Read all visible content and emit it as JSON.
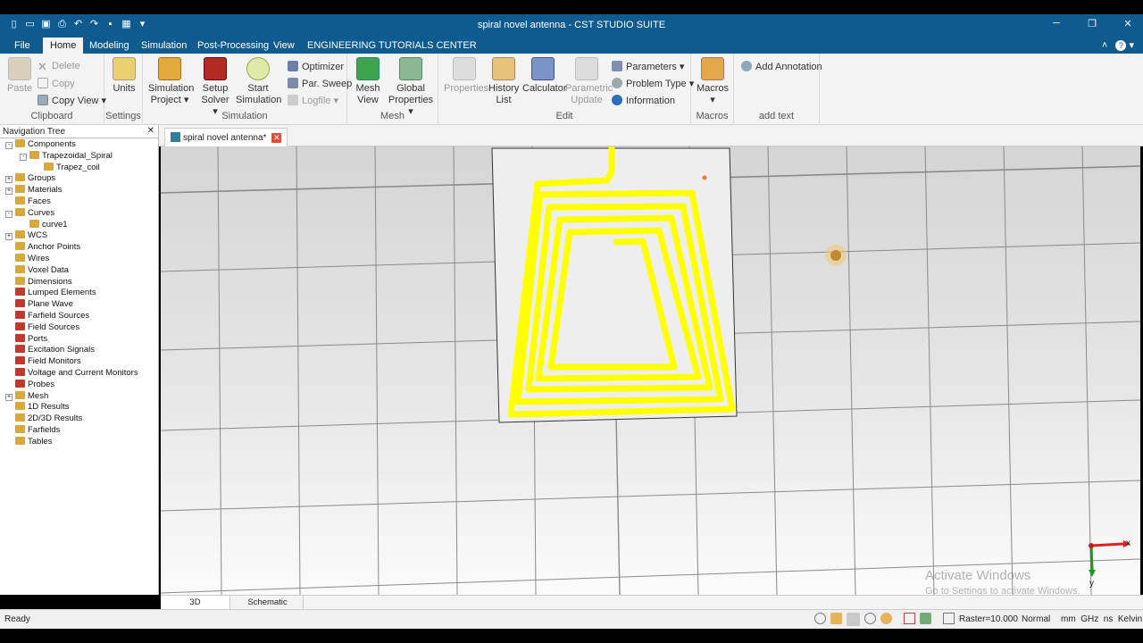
{
  "window": {
    "title": "spiral novel antenna - CST STUDIO SUITE"
  },
  "menu": {
    "tabs": [
      "File",
      "Home",
      "Modeling",
      "Simulation",
      "Post-Processing",
      "View",
      "ENGINEERING TUTORIALS CENTER"
    ],
    "active": "Home"
  },
  "ribbon": {
    "clipboard": {
      "label": "Clipboard",
      "paste": "Paste",
      "delete": "Delete",
      "copy": "Copy",
      "copy_view": "Copy View"
    },
    "settings": {
      "label": "Settings",
      "units": "Units"
    },
    "simulation": {
      "label": "Simulation",
      "sim_project_1": "Simulation",
      "sim_project_2": "Project",
      "setup_1": "Setup",
      "setup_2": "Solver",
      "start_1": "Start",
      "start_2": "Simulation",
      "optimizer": "Optimizer",
      "par_sweep": "Par. Sweep",
      "logfile": "Logfile"
    },
    "mesh": {
      "label": "Mesh",
      "mesh_view_1": "Mesh",
      "mesh_view_2": "View",
      "global_1": "Global",
      "global_2": "Properties"
    },
    "edit": {
      "label": "Edit",
      "properties": "Properties",
      "history_1": "History",
      "history_2": "List",
      "calculator": "Calculator",
      "param_1": "Parametric",
      "param_2": "Update",
      "parameters": "Parameters",
      "problem_type": "Problem Type",
      "information": "Information"
    },
    "macros": {
      "label": "Macros",
      "macros": "Macros"
    },
    "addtext": {
      "label": "add text",
      "add_annotation": "Add Annotation"
    }
  },
  "nav": {
    "header": "Navigation Tree",
    "items": [
      {
        "label": "Components",
        "indent": 0,
        "exp": "-"
      },
      {
        "label": "Trapezoidal_Spiral",
        "indent": 1,
        "exp": "-"
      },
      {
        "label": "Trapez_coil",
        "indent": 2,
        "exp": ""
      },
      {
        "label": "Groups",
        "indent": 0,
        "exp": "+"
      },
      {
        "label": "Materials",
        "indent": 0,
        "exp": "+"
      },
      {
        "label": "Faces",
        "indent": 0,
        "exp": ""
      },
      {
        "label": "Curves",
        "indent": 0,
        "exp": "-"
      },
      {
        "label": "curve1",
        "indent": 1,
        "exp": ""
      },
      {
        "label": "WCS",
        "indent": 0,
        "exp": "+"
      },
      {
        "label": "Anchor Points",
        "indent": 0,
        "exp": ""
      },
      {
        "label": "Wires",
        "indent": 0,
        "exp": ""
      },
      {
        "label": "Voxel Data",
        "indent": 0,
        "exp": ""
      },
      {
        "label": "Dimensions",
        "indent": 0,
        "exp": ""
      },
      {
        "label": "Lumped Elements",
        "indent": 0,
        "exp": ""
      },
      {
        "label": "Plane Wave",
        "indent": 0,
        "exp": ""
      },
      {
        "label": "Farfield Sources",
        "indent": 0,
        "exp": ""
      },
      {
        "label": "Field Sources",
        "indent": 0,
        "exp": ""
      },
      {
        "label": "Ports",
        "indent": 0,
        "exp": ""
      },
      {
        "label": "Excitation Signals",
        "indent": 0,
        "exp": ""
      },
      {
        "label": "Field Monitors",
        "indent": 0,
        "exp": ""
      },
      {
        "label": "Voltage and Current Monitors",
        "indent": 0,
        "exp": ""
      },
      {
        "label": "Probes",
        "indent": 0,
        "exp": ""
      },
      {
        "label": "Mesh",
        "indent": 0,
        "exp": "+"
      },
      {
        "label": "1D Results",
        "indent": 0,
        "exp": ""
      },
      {
        "label": "2D/3D Results",
        "indent": 0,
        "exp": ""
      },
      {
        "label": "Farfields",
        "indent": 0,
        "exp": ""
      },
      {
        "label": "Tables",
        "indent": 0,
        "exp": ""
      }
    ]
  },
  "document": {
    "tab": "spiral novel antenna*"
  },
  "view": {
    "axis_x": "x",
    "axis_y": "y",
    "watermark_1": "Activate Windows",
    "watermark_2": "Go to Settings to activate Windows.",
    "spiral_color": "#ffff00"
  },
  "bottom_tabs": {
    "tab_3d": "3D",
    "tab_schematic": "Schematic"
  },
  "status": {
    "left": "Ready",
    "raster": "Raster=10.000",
    "mode": "Normal",
    "units": "mm  GHz  ns  Kelvin"
  }
}
